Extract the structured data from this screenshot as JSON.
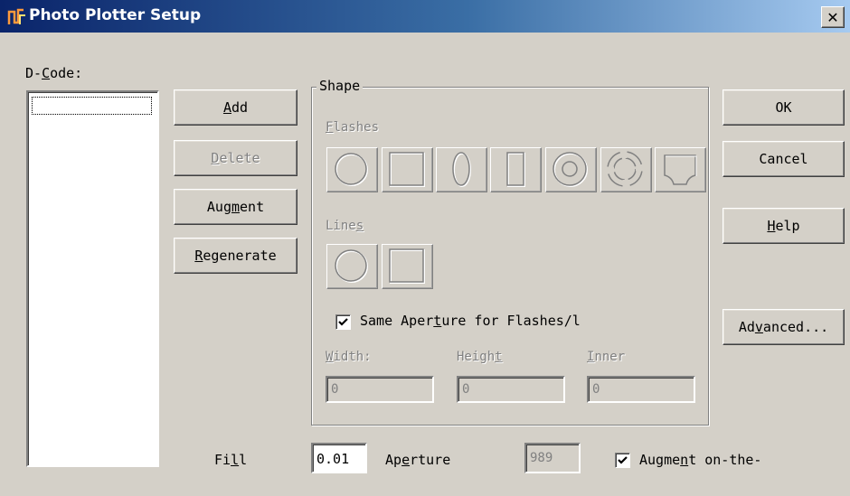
{
  "window": {
    "title": "Photo Plotter Setup",
    "close_glyph": "✕"
  },
  "dcode": {
    "label_pre": "D-",
    "label_key": "C",
    "label_post": "ode:"
  },
  "left_buttons": {
    "add": {
      "key": "A",
      "rest": "dd"
    },
    "delete": {
      "key": "D",
      "rest": "elete"
    },
    "augment": {
      "pre": "Aug",
      "key": "m",
      "post": "ent"
    },
    "regenerate": {
      "key": "R",
      "rest": "egenerate"
    }
  },
  "shape": {
    "legend": "Shape",
    "flashes": {
      "key": "F",
      "rest": "lashes"
    },
    "flash_icons": [
      "circle-flash-icon",
      "square-flash-icon",
      "oval-flash-icon",
      "rectangle-flash-icon",
      "donut-flash-icon",
      "thermal-flash-icon",
      "custom-flash-icon"
    ],
    "lines": {
      "pre": "Line",
      "key": "s",
      "post": ""
    },
    "line_icons": [
      "circle-line-icon",
      "square-line-icon"
    ],
    "same_aperture": {
      "pre": "Same Aper",
      "key": "t",
      "post": "ure for Flashes/l",
      "checked": true
    },
    "width": {
      "key": "W",
      "rest": "idth:",
      "value": "0"
    },
    "height": {
      "pre": "Heigh",
      "key": "t",
      "post": "",
      "value": "0"
    },
    "inner": {
      "key": "I",
      "rest": "nner",
      "value": "0"
    }
  },
  "right_buttons": {
    "ok": "OK",
    "cancel": "Cancel",
    "help": {
      "key": "H",
      "rest": "elp"
    },
    "advanced": {
      "pre": "Ad",
      "key": "v",
      "post": "anced..."
    }
  },
  "bottom": {
    "fill": {
      "pre": "Fi",
      "key": "l",
      "post": "l",
      "value": "0.01"
    },
    "aperture": {
      "pre": "Ap",
      "key": "e",
      "post": "rture",
      "value": "989"
    },
    "augment_otf": {
      "pre": "Augme",
      "key": "n",
      "post": "t on-the-",
      "checked": true
    }
  }
}
